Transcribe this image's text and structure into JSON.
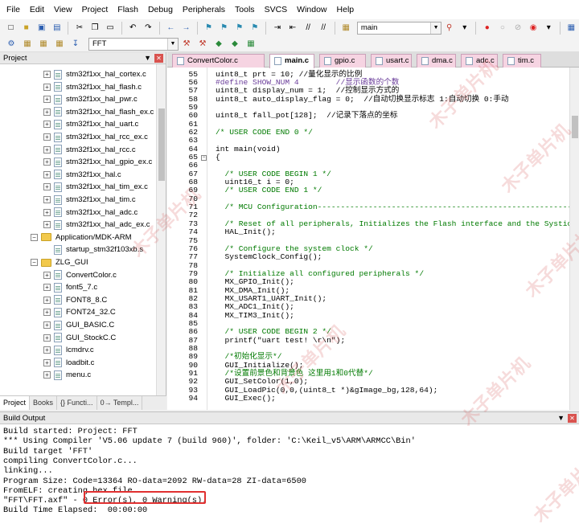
{
  "menu": [
    "File",
    "Edit",
    "View",
    "Project",
    "Flash",
    "Debug",
    "Peripherals",
    "Tools",
    "SVCS",
    "Window",
    "Help"
  ],
  "toolbar": {
    "target_combo": "main",
    "build_target": "FFT"
  },
  "project_panel": {
    "title": "Project",
    "items": [
      {
        "label": "stm32f1xx_hal_cortex.c",
        "type": "file",
        "level": 2
      },
      {
        "label": "stm32f1xx_hal_flash.c",
        "type": "file",
        "level": 2
      },
      {
        "label": "stm32f1xx_hal_pwr.c",
        "type": "file",
        "level": 2
      },
      {
        "label": "stm32f1xx_hal_flash_ex.c",
        "type": "file",
        "level": 2
      },
      {
        "label": "stm32f1xx_hal_uart.c",
        "type": "file",
        "level": 2
      },
      {
        "label": "stm32f1xx_hal_rcc_ex.c",
        "type": "file",
        "level": 2
      },
      {
        "label": "stm32f1xx_hal_rcc.c",
        "type": "file",
        "level": 2
      },
      {
        "label": "stm32f1xx_hal_gpio_ex.c",
        "type": "file",
        "level": 2
      },
      {
        "label": "stm32f1xx_hal.c",
        "type": "file",
        "level": 2
      },
      {
        "label": "stm32f1xx_hal_tim_ex.c",
        "type": "file",
        "level": 2
      },
      {
        "label": "stm32f1xx_hal_tim.c",
        "type": "file",
        "level": 2
      },
      {
        "label": "stm32f1xx_hal_adc.c",
        "type": "file",
        "level": 2
      },
      {
        "label": "stm32f1xx_hal_adc_ex.c",
        "type": "file",
        "level": 2
      },
      {
        "label": "Application/MDK-ARM",
        "type": "folder",
        "level": 1
      },
      {
        "label": "startup_stm32f103xb.s",
        "type": "file",
        "level": 2,
        "noexpand": true
      },
      {
        "label": "ZLG_GUI",
        "type": "folder",
        "level": 1
      },
      {
        "label": "ConvertColor.c",
        "type": "file",
        "level": 2
      },
      {
        "label": "font5_7.c",
        "type": "file",
        "level": 2
      },
      {
        "label": "FONT8_8.C",
        "type": "file",
        "level": 2
      },
      {
        "label": "FONT24_32.C",
        "type": "file",
        "level": 2
      },
      {
        "label": "GUI_BASIC.C",
        "type": "file",
        "level": 2
      },
      {
        "label": "GUI_StockC.C",
        "type": "file",
        "level": 2
      },
      {
        "label": "lcmdrv.c",
        "type": "file",
        "level": 2
      },
      {
        "label": "loadbit.c",
        "type": "file",
        "level": 2
      },
      {
        "label": "menu.c",
        "type": "file",
        "level": 2
      }
    ],
    "tabs": [
      "Project",
      "Books",
      "{} Functi...",
      "0→ Templ..."
    ]
  },
  "editor": {
    "tabs": [
      "ConvertColor.c",
      "main.c",
      "gpio.c",
      "usart.c",
      "dma.c",
      "adc.c",
      "tim.c"
    ],
    "active_tab": "main.c",
    "lines": [
      {
        "n": "55",
        "t": "uint8_t prt = 10; //量化显示的比例"
      },
      {
        "n": "56",
        "t": "#define SHOW_NUM 4        //显示函数的个数"
      },
      {
        "n": "57",
        "t": "uint8_t display_num = 1;  //控制显示方式的"
      },
      {
        "n": "58",
        "t": "uint8_t auto_display_flag = 0;  //自动切换显示标志 1:自动切换 0:手动"
      },
      {
        "n": "59",
        "t": ""
      },
      {
        "n": "60",
        "t": "uint8_t fall_pot[128];  //记录下落点的坐标"
      },
      {
        "n": "61",
        "t": ""
      },
      {
        "n": "62",
        "t": "/* USER CODE END 0 */"
      },
      {
        "n": "63",
        "t": ""
      },
      {
        "n": "64",
        "t": "int main(void)"
      },
      {
        "n": "65",
        "t": "{"
      },
      {
        "n": "66",
        "t": ""
      },
      {
        "n": "67",
        "t": "  /* USER CODE BEGIN 1 */"
      },
      {
        "n": "68",
        "t": "  uint16_t i = 0;"
      },
      {
        "n": "69",
        "t": "  /* USER CODE END 1 */"
      },
      {
        "n": "70",
        "t": ""
      },
      {
        "n": "71",
        "t": "  /* MCU Configuration----------------------------------------------------------"
      },
      {
        "n": "72",
        "t": ""
      },
      {
        "n": "73",
        "t": "  /* Reset of all peripherals, Initializes the Flash interface and the Systick."
      },
      {
        "n": "74",
        "t": "  HAL_Init();"
      },
      {
        "n": "75",
        "t": ""
      },
      {
        "n": "76",
        "t": "  /* Configure the system clock */"
      },
      {
        "n": "77",
        "t": "  SystemClock_Config();"
      },
      {
        "n": "78",
        "t": ""
      },
      {
        "n": "79",
        "t": "  /* Initialize all configured peripherals */"
      },
      {
        "n": "80",
        "t": "  MX_GPIO_Init();"
      },
      {
        "n": "81",
        "t": "  MX_DMA_Init();"
      },
      {
        "n": "82",
        "t": "  MX_USART1_UART_Init();"
      },
      {
        "n": "83",
        "t": "  MX_ADC1_Init();"
      },
      {
        "n": "84",
        "t": "  MX_TIM3_Init();"
      },
      {
        "n": "85",
        "t": ""
      },
      {
        "n": "86",
        "t": "  /* USER CODE BEGIN 2 */"
      },
      {
        "n": "87",
        "t": "  printf(\"uart test! \\r\\n\");"
      },
      {
        "n": "88",
        "t": ""
      },
      {
        "n": "89",
        "t": "  /*初始化显示*/"
      },
      {
        "n": "90",
        "t": "  GUI_Initialize();"
      },
      {
        "n": "91",
        "t": "  /*设置前景色和背景色 这里用1和0代替*/"
      },
      {
        "n": "92",
        "t": "  GUI_SetColor(1,0);"
      },
      {
        "n": "93",
        "t": "  GUI_LoadPic(0,0,(uint8_t *)&gImage_bg,128,64);"
      },
      {
        "n": "94",
        "t": "  GUI_Exec();"
      }
    ]
  },
  "build_output": {
    "title": "Build Output",
    "lines": [
      "Build started: Project: FFT",
      "*** Using Compiler 'V5.06 update 7 (build 960)', folder: 'C:\\Keil_v5\\ARM\\ARMCC\\Bin'",
      "Build target 'FFT'",
      "compiling ConvertColor.c...",
      "linking...",
      "Program Size: Code=13364 RO-data=2092 RW-data=28 ZI-data=6500",
      "FromELF: creating hex file...",
      "\"FFT\\FFT.axf\" - 0 Error(s), 0 Warning(s).",
      "Build Time Elapsed:  00:00:00"
    ]
  },
  "watermark": "木子单片机",
  "colors": {
    "comment": "#007a00",
    "preprocessor": "#6a3d9a",
    "string": "#a31515",
    "highlight": "#e03030",
    "tab_bg": "#f6d4e2"
  }
}
